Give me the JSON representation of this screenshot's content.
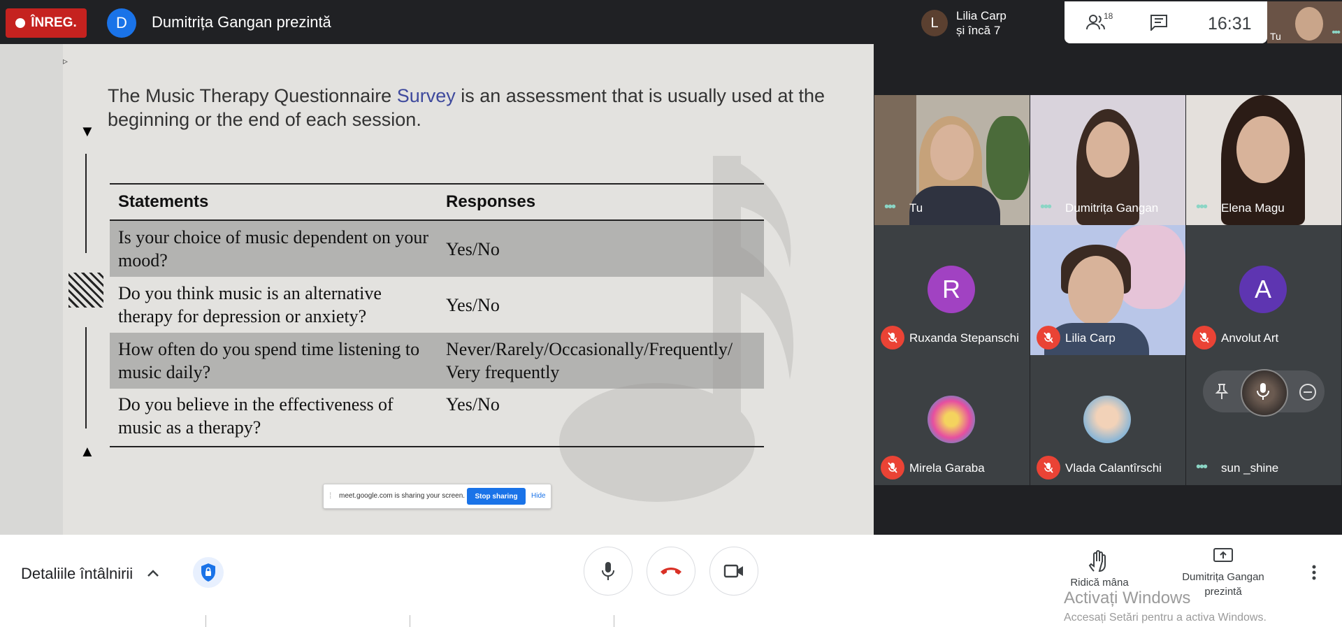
{
  "recording": {
    "label": "ÎNREG."
  },
  "presenter": {
    "avatar_letter": "D",
    "title": "Dumitrița Gangan prezintă"
  },
  "active_speaker": {
    "avatar_letter": "L",
    "line1": "Lilia Carp",
    "line2": "și încă 7"
  },
  "toolbar_top": {
    "people_count": "18",
    "clock": "16:31"
  },
  "self_view": {
    "label": "Tu"
  },
  "slide": {
    "intro_before": "The Music Therapy Questionnaire ",
    "intro_highlight": "Survey",
    "intro_after": " is an assessment that is usually used at the beginning or the end of each session.",
    "table": {
      "headers": [
        "Statements",
        "Responses"
      ],
      "rows": [
        {
          "statement": "Is your choice of music dependent on your mood?",
          "response": "Yes/No"
        },
        {
          "statement": "Do you think music is an alternative therapy for depression or anxiety?",
          "response": "Yes/No"
        },
        {
          "statement": "How often do you spend time listening to music daily?",
          "response": "Never/Rarely/Occasionally/Frequently/ Very frequently"
        },
        {
          "statement": "Do you believe in the effectiveness of music as a therapy?",
          "response": "Yes/No"
        }
      ]
    }
  },
  "share_bar": {
    "message": "meet.google.com is sharing your screen.",
    "stop_label": "Stop sharing",
    "hide_label": "Hide"
  },
  "participants": [
    {
      "name": "Tu",
      "muted": false,
      "kind": "video"
    },
    {
      "name": "Dumitrița Gangan",
      "muted": false,
      "kind": "video"
    },
    {
      "name": "Elena Magu",
      "muted": false,
      "kind": "video"
    },
    {
      "name": "Ruxanda Stepanschi",
      "muted": true,
      "kind": "avatar",
      "letter": "R",
      "color": "#a142c2"
    },
    {
      "name": "Lilia Carp",
      "muted": true,
      "kind": "video"
    },
    {
      "name": "Anvolut Art",
      "muted": true,
      "kind": "avatar",
      "letter": "A",
      "color": "#5e35b1"
    },
    {
      "name": "Mirela Garaba",
      "muted": true,
      "kind": "photo"
    },
    {
      "name": "Vlada Calantîrschi",
      "muted": true,
      "kind": "photo"
    },
    {
      "name": "sun _shine",
      "muted": false,
      "kind": "photo"
    }
  ],
  "bottom": {
    "details_label": "Detaliile întâlnirii",
    "raise_hand_label": "Ridică mâna",
    "present_label": "Dumitrița Gangan prezintă",
    "windows_title": "Activați Windows",
    "windows_sub": "Accesați Setări pentru a activa Windows."
  },
  "colors": {
    "record_red": "#c5221f",
    "accent_blue": "#1a73e8",
    "mute_red": "#ea4335",
    "dark_bg": "#202124"
  }
}
